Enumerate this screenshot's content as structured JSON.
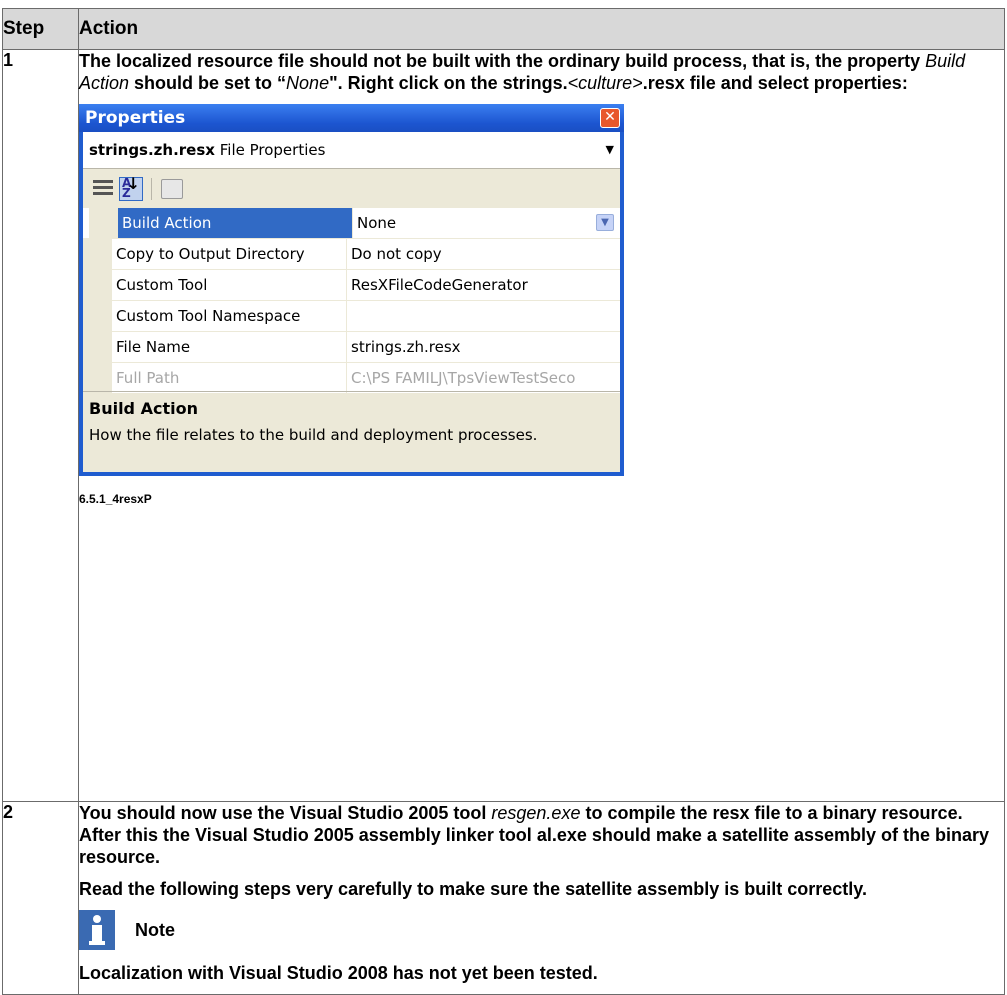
{
  "table": {
    "col_step": "Step",
    "col_action": "Action"
  },
  "step1": {
    "num": "1",
    "t1": "The localized resource file should not be built with the ordinary build process, that is, the property ",
    "t1_it": "Build Action",
    "t2": " should be set to “",
    "t2_it": "None",
    "t3": "\". Right click on the strings.",
    "t3_it": "<culture>",
    "t4": ".resx file and select properties:",
    "caption": "6.5.1_4resxP"
  },
  "props_window": {
    "title": "Properties",
    "close_glyph": "✕",
    "selector_file": "strings.zh.resx",
    "selector_type": " File Properties",
    "rows": [
      {
        "name": "Build Action",
        "value": "None"
      },
      {
        "name": "Copy to Output Directory",
        "value": "Do not copy"
      },
      {
        "name": "Custom Tool",
        "value": "ResXFileCodeGenerator"
      },
      {
        "name": "Custom Tool Namespace",
        "value": ""
      },
      {
        "name": "File Name",
        "value": "strings.zh.resx"
      },
      {
        "name": "Full Path",
        "value": "C:\\PS FAMILJ\\TpsViewTestSeco"
      }
    ],
    "desc_title": "Build Action",
    "desc_text": "How the file relates to the build and deployment processes."
  },
  "step2": {
    "num": "2",
    "p1a": "You should now use the Visual Studio 2005 tool ",
    "p1_it": "resgen.exe",
    "p1b": " to compile the resx file to a binary resource. After this the Visual Studio 2005 assembly linker tool ",
    "p1_bold": "al.exe",
    "p1c": " should make a satellite assembly of the binary resource.",
    "p2": "Read the following steps very carefully to make sure the satellite assembly is built correctly.",
    "note_label": "Note",
    "p3": "Localization with Visual Studio 2008 has not yet been tested."
  }
}
